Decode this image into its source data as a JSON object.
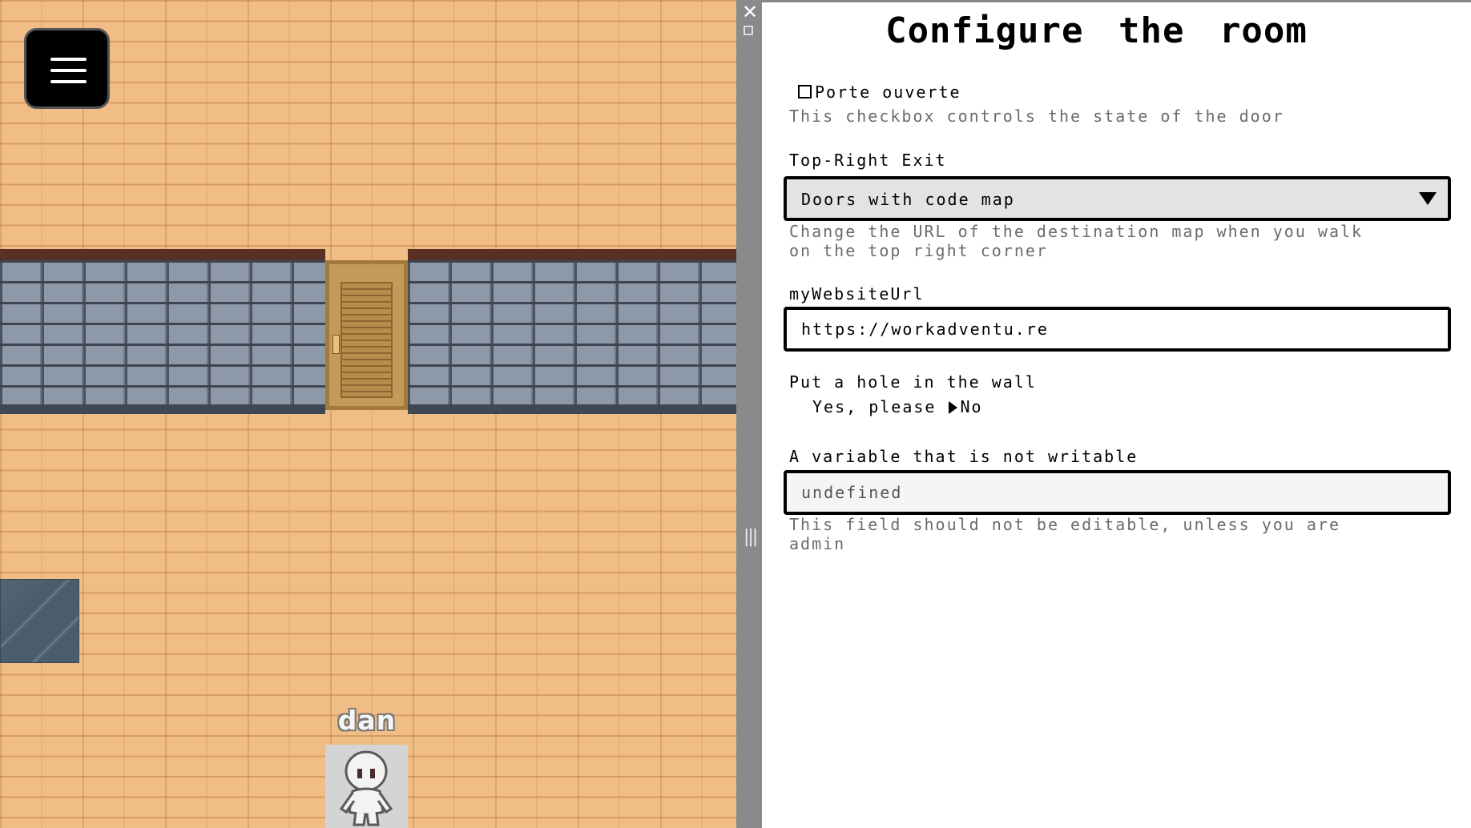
{
  "game": {
    "menu_icon": "hamburger-menu-icon",
    "player_name": "dan"
  },
  "divider": {
    "close_glyph": "✕",
    "grip_glyph": "|||"
  },
  "panel": {
    "title": "Configure the room",
    "door": {
      "label": "Porte ouverte",
      "checked": false,
      "description": "This checkbox controls the state of the door"
    },
    "exit": {
      "label": "Top-Right Exit",
      "selected": "Doors with code map",
      "description_line1": "Change the URL of the destination map when you walk",
      "description_line2": "on the top right corner"
    },
    "website": {
      "label": "myWebsiteUrl",
      "value": "https://workadventu.re"
    },
    "hole": {
      "label": "Put a hole in the wall",
      "option_yes": "Yes, please",
      "option_no": "No",
      "selected": "No"
    },
    "readonly_var": {
      "label": "A variable that is not writable",
      "value": "undefined",
      "description_line1": "This field should not be editable, unless you are",
      "description_line2": "admin"
    }
  }
}
